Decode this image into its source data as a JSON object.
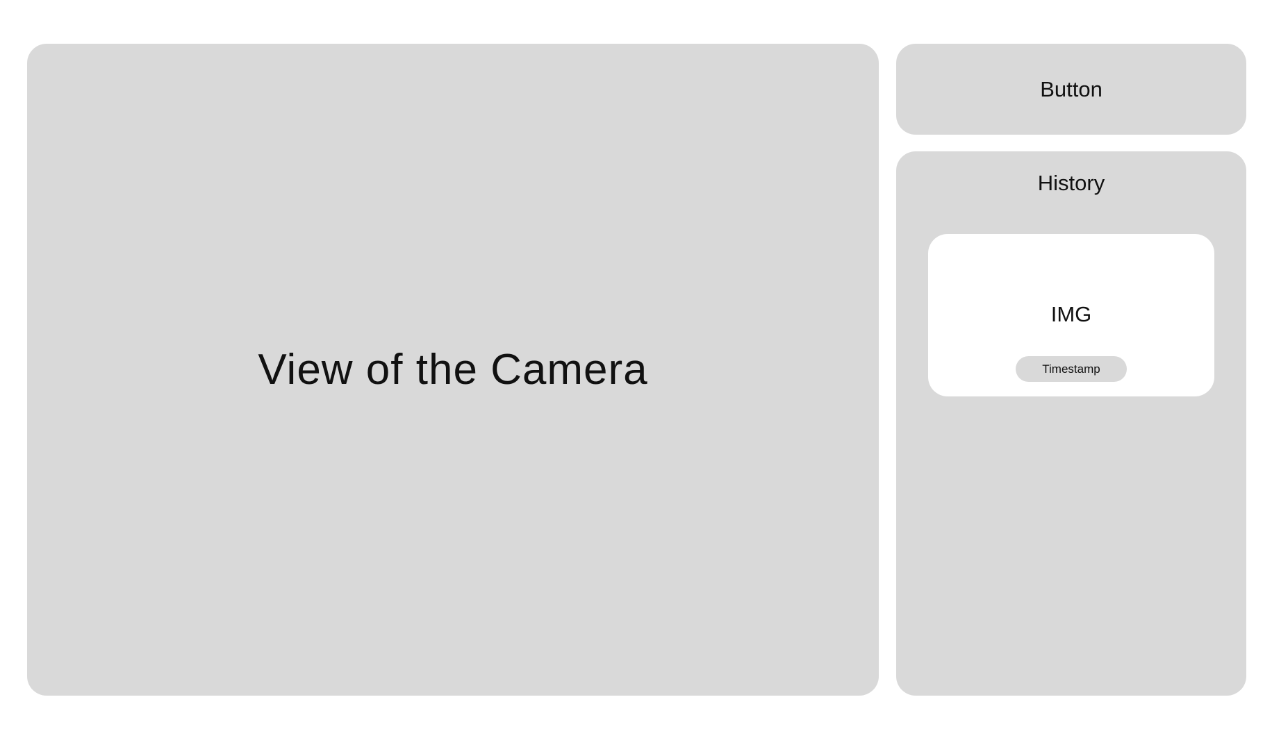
{
  "camera": {
    "label": "View of the Camera"
  },
  "action_button": {
    "label": "Button"
  },
  "history": {
    "title": "History",
    "items": [
      {
        "image_label": "IMG",
        "timestamp": "Timestamp"
      }
    ]
  },
  "colors": {
    "panel": "#d9d9d9",
    "card": "#ffffff",
    "text": "#111111",
    "background": "#ffffff"
  }
}
